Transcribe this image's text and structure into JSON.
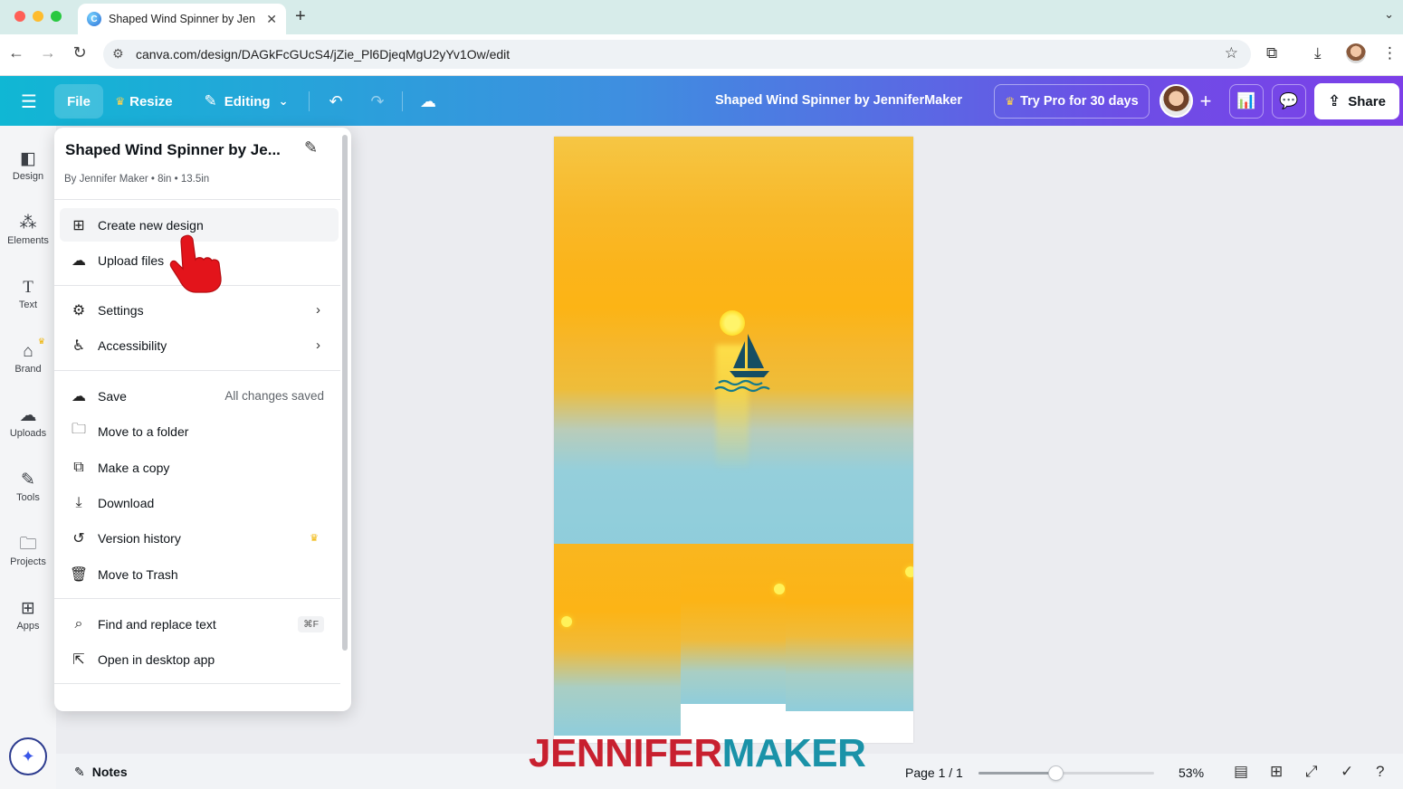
{
  "browser": {
    "tab_title": "Shaped Wind Spinner by Jen",
    "url": "canva.com/design/DAGkFcGUcS4/jZie_Pl6DjeqMgU2yYv1Ow/edit",
    "traffic_colors": [
      "#ff5f57",
      "#febc2e",
      "#28c840"
    ]
  },
  "header": {
    "file_label": "File",
    "resize_label": "Resize",
    "editing_label": "Editing",
    "doc_title": "Shaped Wind Spinner by JenniferMaker",
    "try_pro_label": "Try Pro for 30 days",
    "share_label": "Share"
  },
  "left_rail": {
    "items": [
      {
        "label": "Design",
        "icon": "layout-icon"
      },
      {
        "label": "Elements",
        "icon": "shapes-icon"
      },
      {
        "label": "Text",
        "icon": "text-icon"
      },
      {
        "label": "Brand",
        "icon": "brand-icon"
      },
      {
        "label": "Uploads",
        "icon": "cloud-upload-icon"
      },
      {
        "label": "Tools",
        "icon": "pen-tool-icon"
      },
      {
        "label": "Projects",
        "icon": "folder-icon"
      },
      {
        "label": "Apps",
        "icon": "apps-icon"
      }
    ]
  },
  "file_menu": {
    "title": "Shaped Wind Spinner by Je...",
    "meta": "By Jennifer Maker • 8in • 13.5in",
    "items": [
      {
        "label": "Create new design",
        "icon": "plus-square-icon"
      },
      {
        "label": "Upload files",
        "icon": "cloud-upload-icon"
      },
      {
        "label": "Settings",
        "icon": "gear-icon"
      },
      {
        "label": "Accessibility",
        "icon": "accessibility-icon"
      },
      {
        "label": "Save",
        "icon": "cloud-check-icon",
        "status": "All changes saved"
      },
      {
        "label": "Move to a folder",
        "icon": "folder-icon"
      },
      {
        "label": "Make a copy",
        "icon": "copy-icon"
      },
      {
        "label": "Download",
        "icon": "download-icon"
      },
      {
        "label": "Version history",
        "icon": "history-icon"
      },
      {
        "label": "Move to Trash",
        "icon": "trash-icon"
      },
      {
        "label": "Find and replace text",
        "icon": "search-icon",
        "shortcut": "⌘F"
      },
      {
        "label": "Open in desktop app",
        "icon": "external-link-icon"
      }
    ]
  },
  "bottom": {
    "notes_label": "Notes",
    "page_label": "Page 1 / 1",
    "zoom_label": "53%",
    "zoom_fraction": 0.44
  },
  "watermark": {
    "part1": "JENNIFER",
    "part2": "MAKER"
  },
  "colors": {
    "accent": "#7d2ae8",
    "header_start": "#10b7d4",
    "header_end": "#7c3fe8",
    "crown": "#f0b400"
  }
}
